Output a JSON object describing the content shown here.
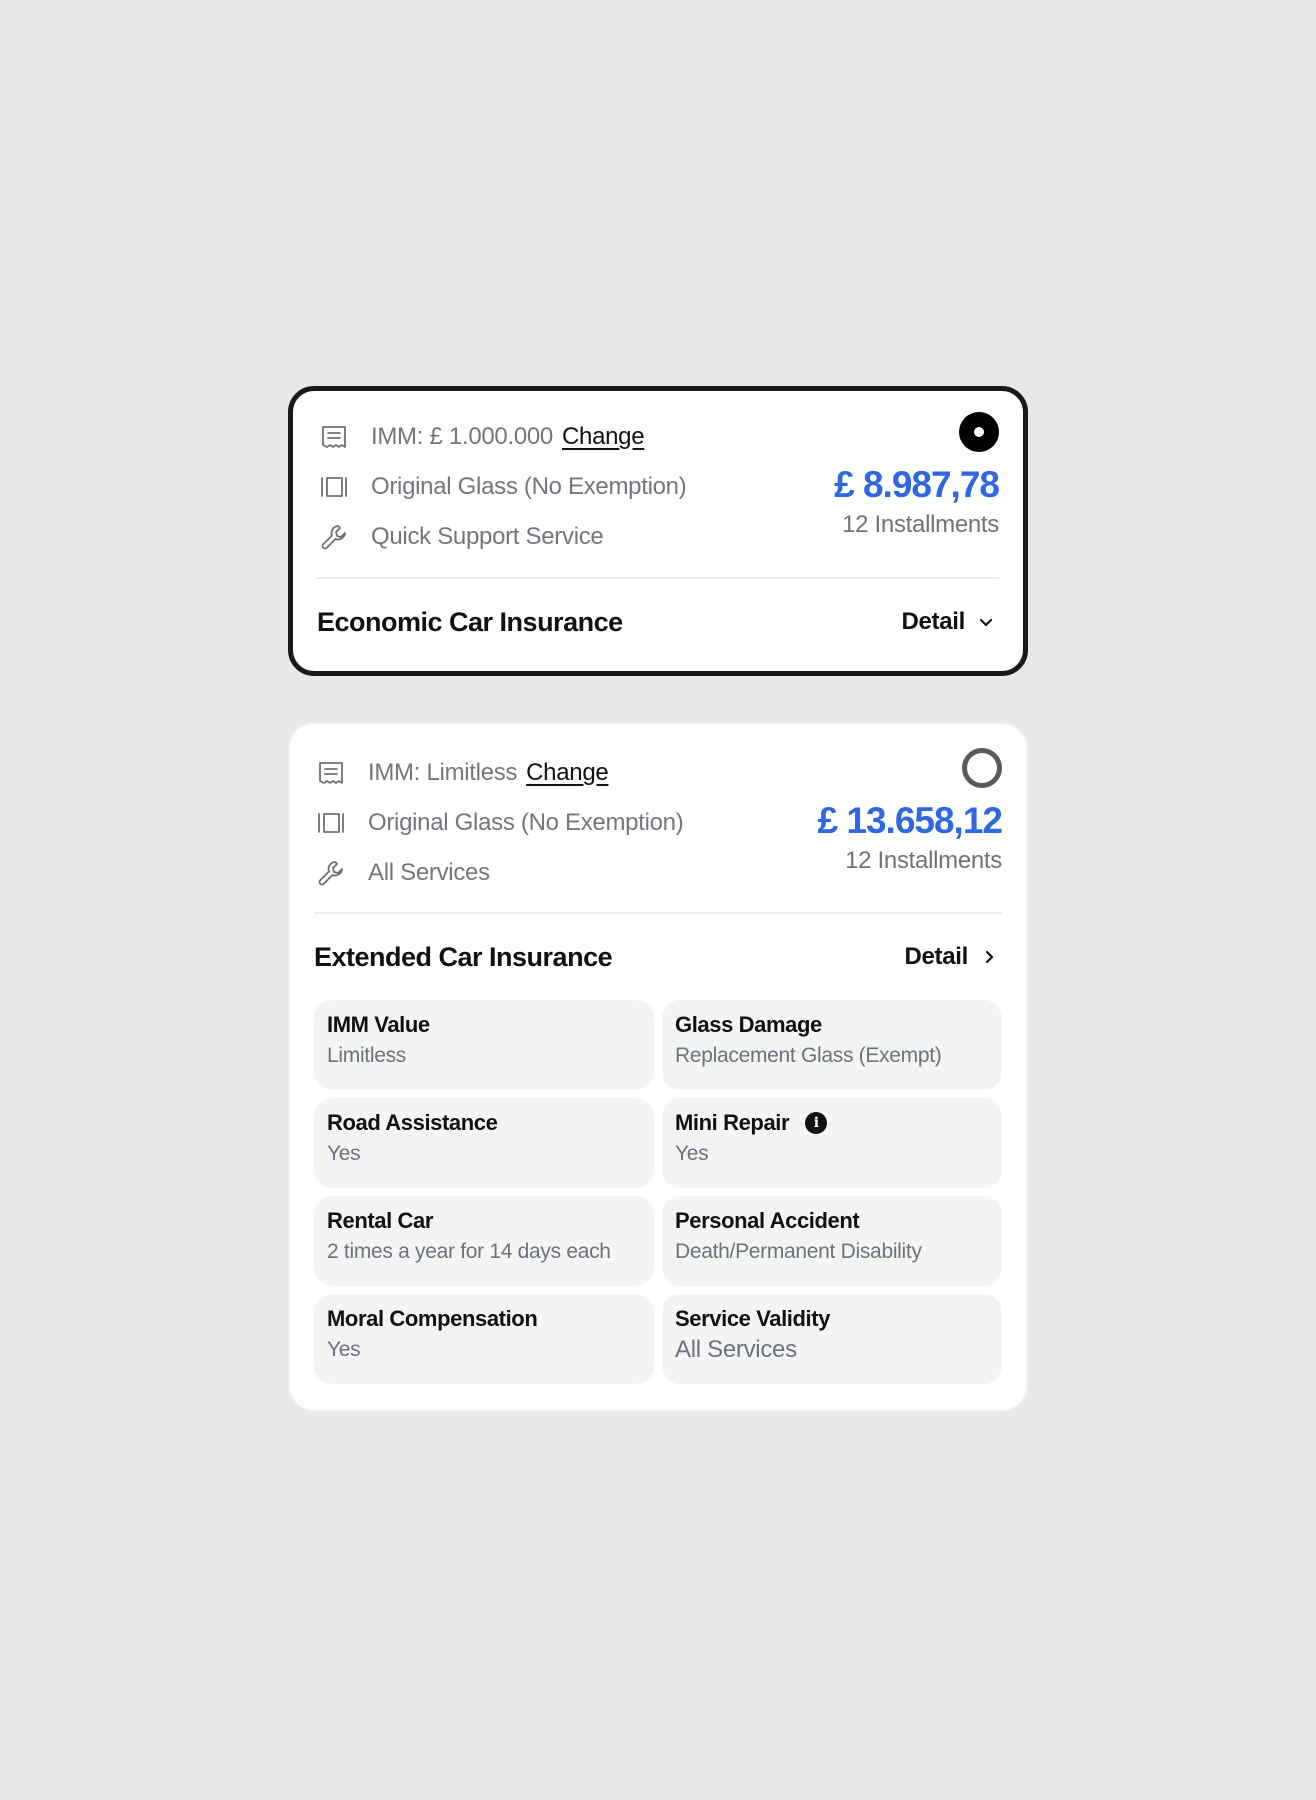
{
  "plans": [
    {
      "name": "Economic Car Insurance",
      "selected": true,
      "imm_label": "IMM: £ 1.000.000",
      "change_label": "Change",
      "features": [
        "Original Glass (No Exemption)",
        "Quick Support Service"
      ],
      "price": "£ 8.987,78",
      "installments": "12 Installments",
      "detail_label": "Detail",
      "detail_icon": "chevron-down-icon"
    },
    {
      "name": "Extended Car Insurance",
      "selected": false,
      "imm_label": "IMM: Limitless",
      "change_label": "Change",
      "features": [
        "Original Glass (No Exemption)",
        "All Services"
      ],
      "price": "£ 13.658,12",
      "installments": "12 Installments",
      "detail_label": "Detail",
      "detail_icon": "chevron-right-icon",
      "details": [
        {
          "label": "IMM Value",
          "value": "Limitless"
        },
        {
          "label": "Glass Damage",
          "value": "Replacement Glass (Exempt)"
        },
        {
          "label": "Road Assistance",
          "value": "Yes"
        },
        {
          "label": "Mini Repair",
          "value": "Yes",
          "info": "i"
        },
        {
          "label": "Rental Car",
          "value": "2 times a year for 14 days each"
        },
        {
          "label": "Personal Accident",
          "value": "Death/Permanent Disability"
        },
        {
          "label": "Moral Compensation",
          "value": "Yes"
        },
        {
          "label": "Service Validity",
          "value": "All Services"
        }
      ]
    }
  ],
  "colors": {
    "background": "#e8e8e8",
    "price": "#2e67e0",
    "muted_text": "#73777d",
    "selected_border": "#1a1a1a"
  }
}
